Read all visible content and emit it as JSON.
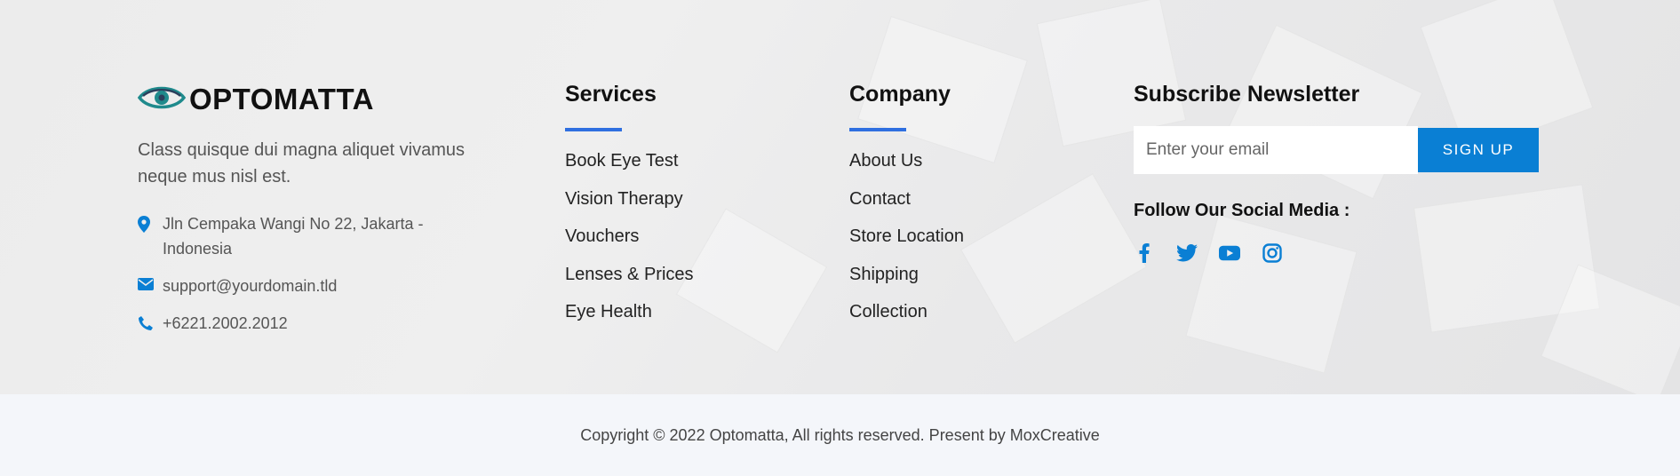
{
  "brand": {
    "name": "OPTOMATTA"
  },
  "about": {
    "text": "Class quisque dui magna aliquet vivamus neque mus nisl est."
  },
  "contact": {
    "address": "Jln Cempaka Wangi No 22, Jakarta - Indonesia",
    "email": "support@yourdomain.tld",
    "phone": "+6221.2002.2012"
  },
  "services": {
    "heading": "Services",
    "links": [
      "Book Eye Test",
      "Vision Therapy",
      "Vouchers",
      "Lenses & Prices",
      "Eye Health"
    ]
  },
  "company": {
    "heading": "Company",
    "links": [
      "About Us",
      "Contact",
      "Store Location",
      "Shipping",
      "Collection"
    ]
  },
  "newsletter": {
    "heading": "Subscribe Newsletter",
    "email_placeholder": "Enter your email",
    "signup_label": "SIGN UP",
    "follow_label": "Follow Our Social Media :"
  },
  "social_icons": [
    "facebook-icon",
    "twitter-icon",
    "youtube-icon",
    "instagram-icon"
  ],
  "footer": {
    "copyright": "Copyright © 2022 Optomatta, All rights reserved. Present by MoxCreative"
  },
  "colors": {
    "accent": "#0a7fd4",
    "underline": "#2f6fe0",
    "logo_teal": "#1f8a8c",
    "heading": "#111111"
  }
}
